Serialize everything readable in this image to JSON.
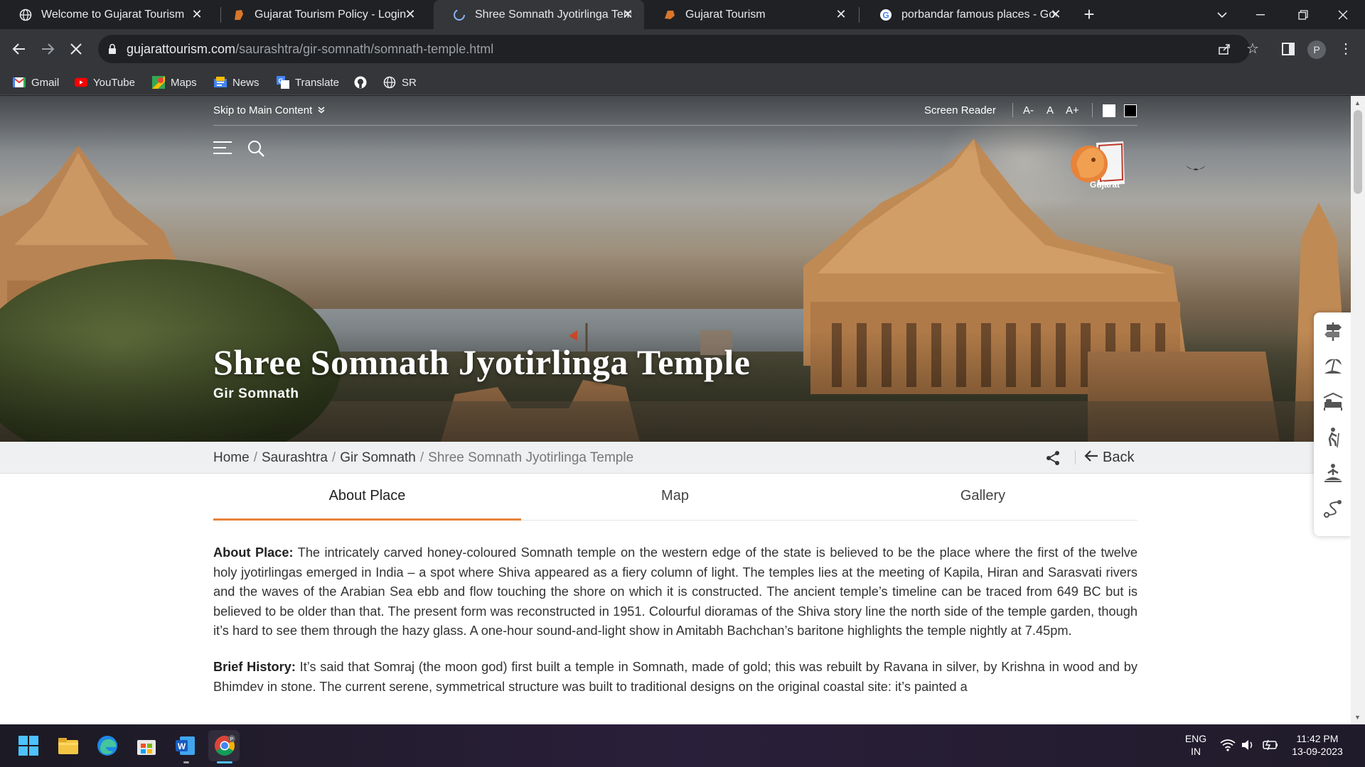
{
  "browser": {
    "tabs": [
      {
        "title": "Welcome to Gujarat Tourism",
        "icon": "globe-icon"
      },
      {
        "title": "Gujarat Tourism Policy - Login",
        "icon": "lion-icon"
      },
      {
        "title": "Shree Somnath Jyotirlinga Templ",
        "icon": "loading-icon"
      },
      {
        "title": "Gujarat Tourism",
        "icon": "lion-icon"
      },
      {
        "title": "porbandar famous places - Goog",
        "icon": "google-icon"
      }
    ],
    "url_host": "gujarattourism.com",
    "url_path": "/saurashtra/gir-somnath/somnath-temple.html",
    "profile_initial": "P",
    "bookmarks": [
      {
        "label": "Gmail",
        "icon": "gmail-icon"
      },
      {
        "label": "YouTube",
        "icon": "youtube-icon"
      },
      {
        "label": "Maps",
        "icon": "maps-icon"
      },
      {
        "label": "News",
        "icon": "news-icon"
      },
      {
        "label": "Translate",
        "icon": "translate-icon"
      },
      {
        "label": "",
        "icon": "github-icon"
      },
      {
        "label": "SR",
        "icon": "globe-icon"
      }
    ]
  },
  "site": {
    "skip_label": "Skip to Main Content",
    "screen_reader": "Screen Reader",
    "font_smaller": "A-",
    "font_normal": "A",
    "font_larger": "A+",
    "logo_text": "Gujarat",
    "hero_title": "Shree Somnath Jyotirlinga Temple",
    "hero_subtitle": "Gir Somnath",
    "breadcrumbs": [
      "Home",
      "Saurashtra",
      "Gir Somnath",
      "Shree Somnath Jyotirlinga Temple"
    ],
    "back_label": "Back",
    "tabs": [
      "About Place",
      "Map",
      "Gallery"
    ],
    "about_heading": "About Place:",
    "about_text": " The intricately carved honey-coloured Somnath temple on the western edge of the state is believed to be the place where the first of the twelve holy jyotirlingas emerged in India – a spot where Shiva appeared as a fiery column of light. The temples lies at the meeting of Kapila, Hiran and Sarasvati rivers and the waves of the Arabian Sea ebb and flow touching the shore on which it is constructed. The ancient temple’s timeline can be traced from 649 BC but is believed to be older than that. The present form was reconstructed in 1951. Colourful dioramas of the Shiva story line the north side of the temple garden, though it’s hard to see them through the hazy glass. A one-hour sound-and-light show in Amitabh Bachchan’s baritone highlights the temple nightly at 7.45pm.",
    "history_heading": "Brief History:",
    "history_text": " It’s said that Somraj (the moon god) first built a temple in Somnath, made of gold; this was rebuilt by Ravana in silver, by Krishna in wood and by Bhimdev in stone. The current serene, symmetrical structure was built to traditional designs on the original coastal site: it’s painted a",
    "side_icons": [
      "signpost-icon",
      "beach-icon",
      "hotel-bed-icon",
      "hiking-icon",
      "meditation-icon",
      "route-icon"
    ]
  },
  "taskbar": {
    "lang_top": "ENG",
    "lang_bottom": "IN",
    "time": "11:42 PM",
    "date": "13-09-2023"
  },
  "colors": {
    "accent_tab": "#e8833a",
    "browser_dark": "#202124",
    "browser_toolbar": "#35363a"
  }
}
